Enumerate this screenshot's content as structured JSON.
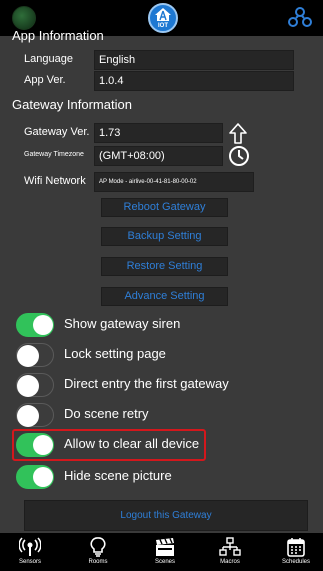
{
  "app_information_title": "App Information",
  "app_info": {
    "language_label": "Language",
    "language_value": "English",
    "app_ver_label": "App Ver.",
    "app_ver_value": "1.0.4"
  },
  "gateway_information_title": "Gateway Information",
  "gateway_info": {
    "gateway_ver_label": "Gateway Ver.",
    "gateway_ver_value": "1.73",
    "timezone_label": "Gateway Timezone",
    "timezone_value": "(GMT+08:00)",
    "wifi_label": "Wifi Network",
    "wifi_value": "AP Mode - airlive-00-41-81-80-00-02"
  },
  "buttons": {
    "reboot": "Reboot Gateway",
    "backup": "Backup Setting",
    "restore": "Restore Setting",
    "advance": "Advance Setting",
    "logout": "Logout this Gateway"
  },
  "brand": {
    "logo_text": "IOT"
  },
  "toggles": [
    {
      "label": "Show gateway siren",
      "on": true
    },
    {
      "label": "Lock setting page",
      "on": false
    },
    {
      "label": "Direct entry the first gateway",
      "on": false
    },
    {
      "label": "Do scene retry",
      "on": false
    },
    {
      "label": "Allow to clear all device",
      "on": true
    },
    {
      "label": "Hide scene picture",
      "on": true
    }
  ],
  "nav": [
    {
      "label": "Sensors",
      "icon": "sensor-icon"
    },
    {
      "label": "Rooms",
      "icon": "bulb-icon"
    },
    {
      "label": "Scenes",
      "icon": "clapperboard-icon"
    },
    {
      "label": "Macros",
      "icon": "macro-icon"
    },
    {
      "label": "Schedules",
      "icon": "calendar-icon"
    }
  ],
  "colors": {
    "background": "#3a3a3a",
    "accent_blue": "#2f7fd8",
    "toggle_on": "#31c25a",
    "highlight_red": "#d4171c"
  }
}
